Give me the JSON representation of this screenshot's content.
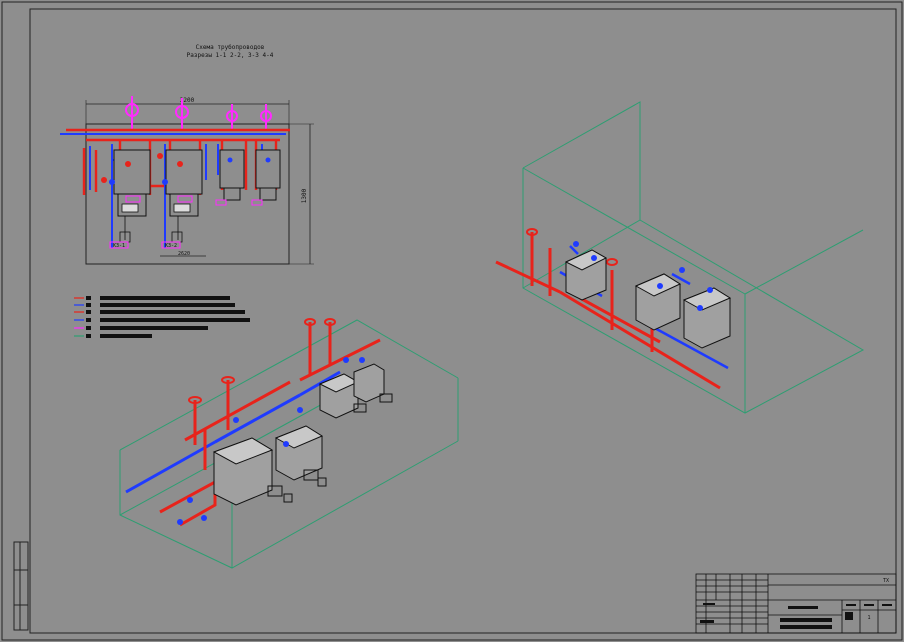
{
  "drawing": {
    "title_line1": "Схема трубопроводов",
    "title_line2": "Разрезы 1-1 2-2, 3-3 4-4",
    "dim_width": "3200",
    "dim_height": "1300",
    "dim_bottom": "2620",
    "sheet_label": "ТХ",
    "sheet_number": "1",
    "unit_labels": [
      "КЗ-1",
      "КЗ-2"
    ]
  },
  "colors": {
    "background": "#8e8e8e",
    "supply": "#e8231b",
    "return": "#1f3bff",
    "gas": "#ff2bff",
    "walls": "#2e9e72",
    "ink": "#111111"
  }
}
